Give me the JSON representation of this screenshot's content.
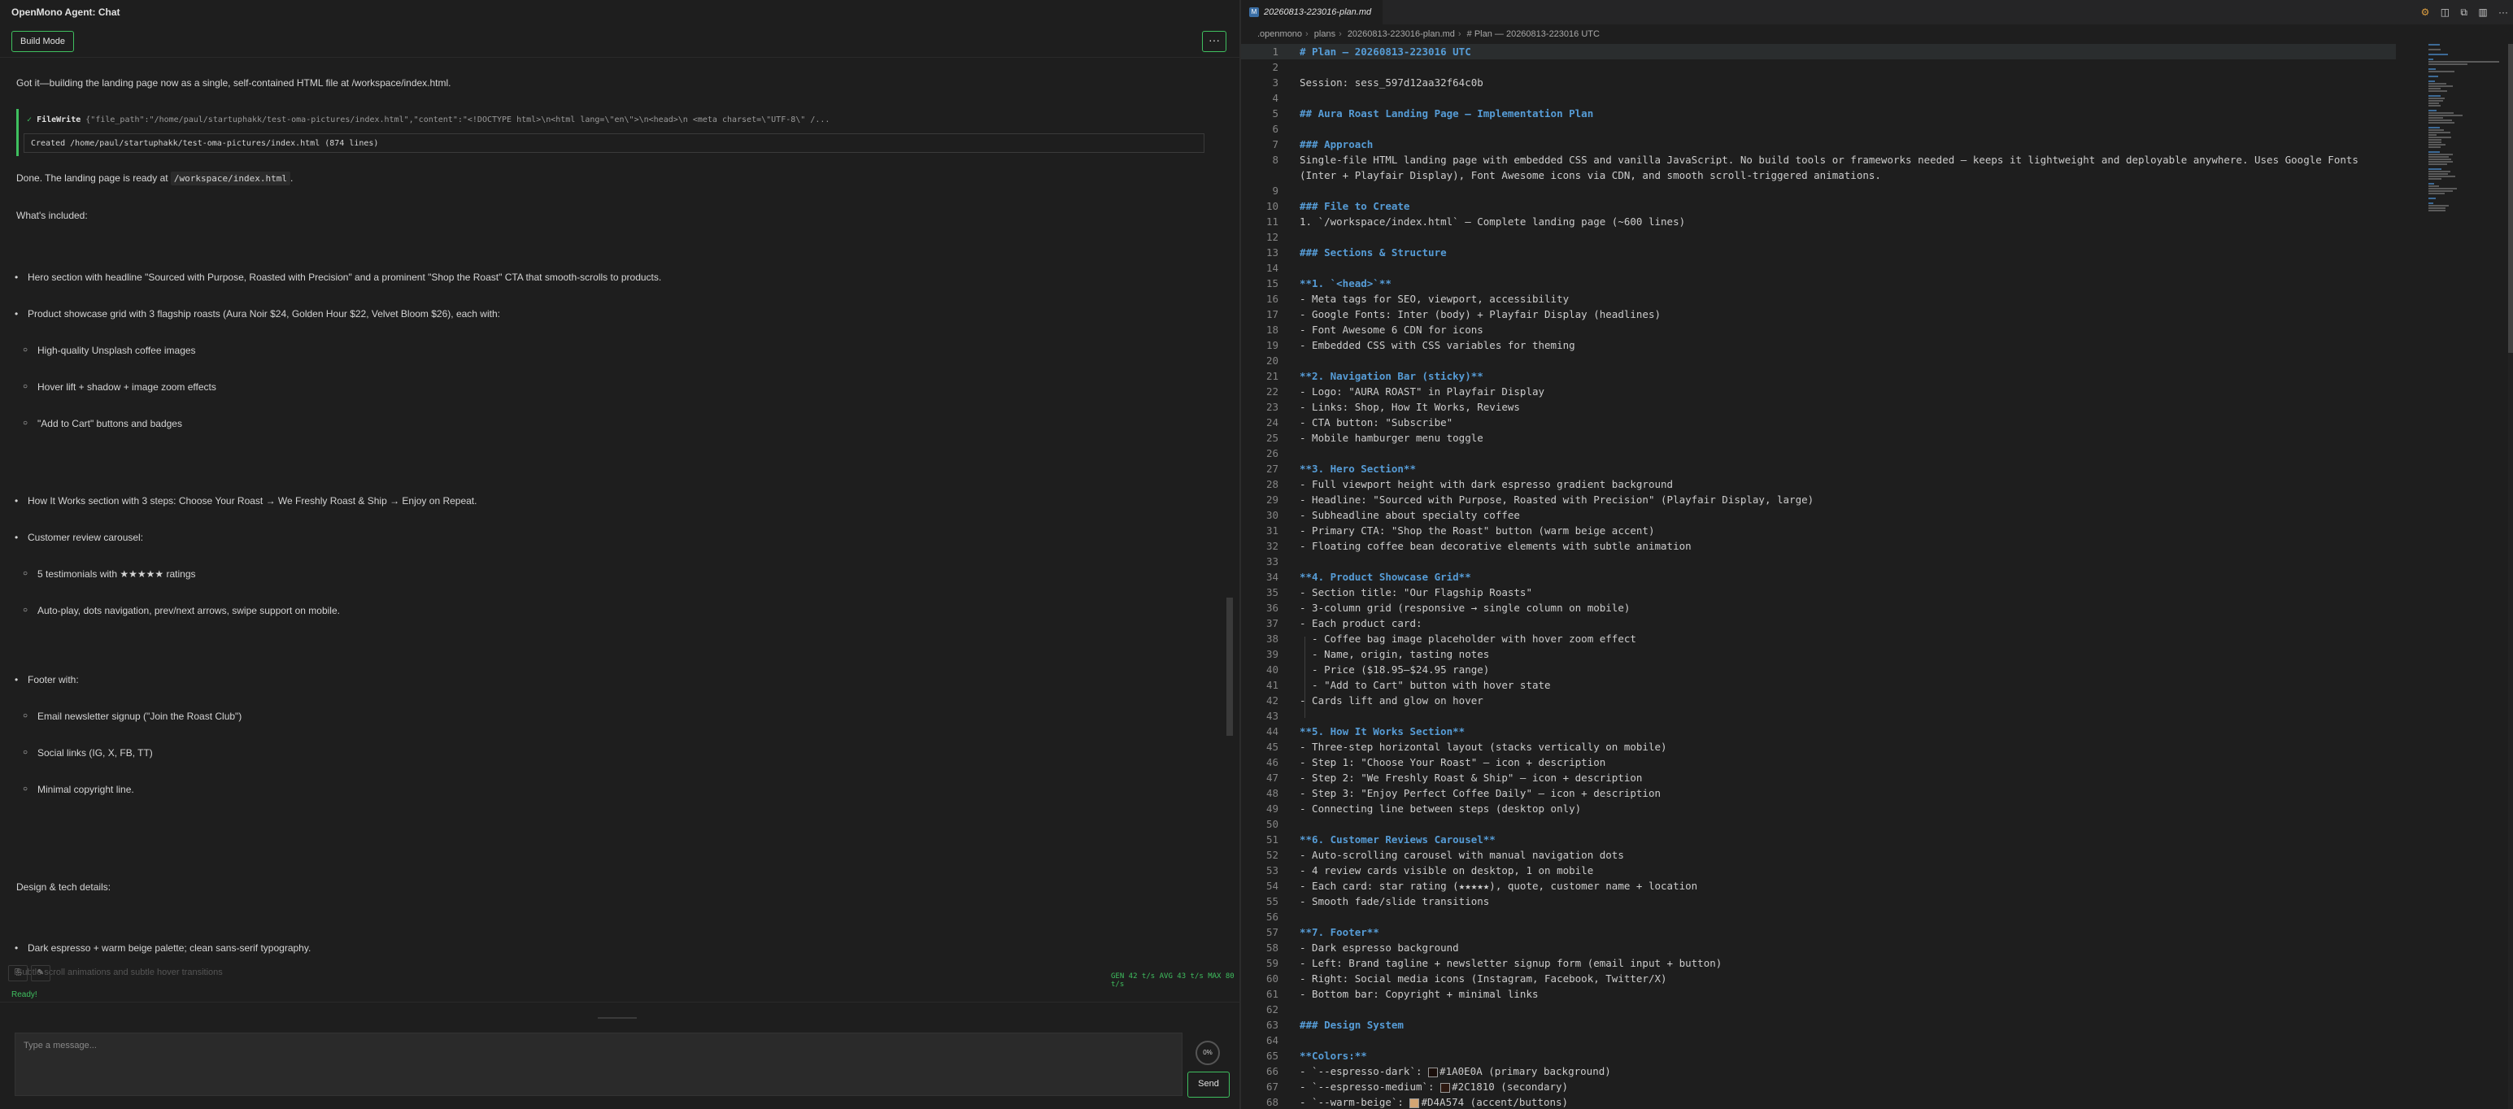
{
  "chat": {
    "title": "OpenMono Agent: Chat",
    "build_mode": "Build Mode",
    "more_label": "···",
    "intro": "Got it—building the landing page now as a single, self-contained HTML file at /workspace/index.html.",
    "tool": {
      "check": "✓",
      "name": "FileWrite",
      "args": "{\"file_path\":\"/home/paul/startuphakk/test-oma-pictures/index.html\",\"content\":\"<!DOCTYPE html>\\n<html lang=\\\"en\\\">\\n<head>\\n  <meta charset=\\\"UTF-8\\\" /...",
      "result": "Created /home/paul/startuphakk/test-oma-pictures/index.html (874 lines)"
    },
    "done_prefix": "Done. The landing page is ready at ",
    "done_path": "/workspace/index.html",
    "done_suffix": ".",
    "included": "What's included:",
    "bullets": {
      "hero": "Hero section with headline \"Sourced with Purpose, Roasted with Precision\" and a prominent \"Shop the Roast\" CTA that smooth-scrolls to products.",
      "product": "Product showcase grid with 3 flagship roasts (Aura Noir $24, Golden Hour $22, Velvet Bloom $26), each with:",
      "product_sub": [
        "High-quality Unsplash coffee images",
        "Hover lift + shadow + image zoom effects",
        "\"Add to Cart\" buttons and badges"
      ],
      "how": "How It Works section with 3 steps: Choose Your Roast → We Freshly Roast & Ship → Enjoy on Repeat.",
      "reviews": "Customer review carousel:",
      "reviews_sub": [
        "5 testimonials with ★★★★★ ratings",
        "Auto-play, dots navigation, prev/next arrows, swipe support on mobile."
      ],
      "footer": "Footer with:",
      "footer_sub": [
        "Email newsletter signup (\"Join the Roast Club\")",
        "Social links (IG, X, FB, TT)",
        "Minimal copyright line."
      ],
      "design_heading": "Design & tech details:",
      "design_first": "Dark espresso + warm beige palette; clean sans-serif typography.",
      "faded": "Subtle scroll animations and subtle hover transitions"
    },
    "gen_stats": "GEN 42 t/s AVG 43 t/s MAX 80 t/s",
    "status": "Ready!",
    "input_placeholder": "Type a message...",
    "progress": "0%",
    "send": "Send"
  },
  "editor": {
    "tab": "20260813-223016-plan.md",
    "breadcrumb": [
      ".openmono",
      "plans",
      "20260813-223016-plan.md",
      "# Plan — 20260813-223016 UTC"
    ],
    "lines": [
      {
        "n": "1",
        "t": "# Plan — 20260813-223016 UTC",
        "k": "h"
      },
      {
        "n": "2",
        "t": "",
        "k": ""
      },
      {
        "n": "3",
        "t": "Session: sess_597d12aa32f64c0b",
        "k": ""
      },
      {
        "n": "4",
        "t": "",
        "k": ""
      },
      {
        "n": "5",
        "t": "## Aura Roast Landing Page — Implementation Plan",
        "k": "h"
      },
      {
        "n": "6",
        "t": "",
        "k": ""
      },
      {
        "n": "7",
        "t": "### Approach",
        "k": "h"
      },
      {
        "n": "8",
        "t": "Single-file HTML landing page with embedded CSS and vanilla JavaScript. No build tools or frameworks needed — keeps it lightweight and deployable anywhere. Uses Google Fonts",
        "k": ""
      },
      {
        "n": "",
        "t": "(Inter + Playfair Display), Font Awesome icons via CDN, and smooth scroll-triggered animations.",
        "k": ""
      },
      {
        "n": "9",
        "t": "",
        "k": ""
      },
      {
        "n": "10",
        "t": "### File to Create",
        "k": "h"
      },
      {
        "n": "11",
        "t": "1. `/workspace/index.html` — Complete landing page (~600 lines)",
        "k": ""
      },
      {
        "n": "12",
        "t": "",
        "k": ""
      },
      {
        "n": "13",
        "t": "### Sections & Structure",
        "k": "h"
      },
      {
        "n": "14",
        "t": "",
        "k": ""
      },
      {
        "n": "15",
        "t": "**1. `<head>`**",
        "k": "b"
      },
      {
        "n": "16",
        "t": "- Meta tags for SEO, viewport, accessibility",
        "k": ""
      },
      {
        "n": "17",
        "t": "- Google Fonts: Inter (body) + Playfair Display (headlines)",
        "k": ""
      },
      {
        "n": "18",
        "t": "- Font Awesome 6 CDN for icons",
        "k": ""
      },
      {
        "n": "19",
        "t": "- Embedded CSS with CSS variables for theming",
        "k": ""
      },
      {
        "n": "20",
        "t": "",
        "k": ""
      },
      {
        "n": "21",
        "t": "**2. Navigation Bar (sticky)**",
        "k": "b"
      },
      {
        "n": "22",
        "t": "- Logo: \"AURA ROAST\" in Playfair Display",
        "k": ""
      },
      {
        "n": "23",
        "t": "- Links: Shop, How It Works, Reviews",
        "k": ""
      },
      {
        "n": "24",
        "t": "- CTA button: \"Subscribe\"",
        "k": ""
      },
      {
        "n": "25",
        "t": "- Mobile hamburger menu toggle",
        "k": ""
      },
      {
        "n": "26",
        "t": "",
        "k": ""
      },
      {
        "n": "27",
        "t": "**3. Hero Section**",
        "k": "b"
      },
      {
        "n": "28",
        "t": "- Full viewport height with dark espresso gradient background",
        "k": ""
      },
      {
        "n": "29",
        "t": "- Headline: \"Sourced with Purpose, Roasted with Precision\" (Playfair Display, large)",
        "k": ""
      },
      {
        "n": "30",
        "t": "- Subheadline about specialty coffee",
        "k": ""
      },
      {
        "n": "31",
        "t": "- Primary CTA: \"Shop the Roast\" button (warm beige accent)",
        "k": ""
      },
      {
        "n": "32",
        "t": "- Floating coffee bean decorative elements with subtle animation",
        "k": ""
      },
      {
        "n": "33",
        "t": "",
        "k": ""
      },
      {
        "n": "34",
        "t": "**4. Product Showcase Grid**",
        "k": "b"
      },
      {
        "n": "35",
        "t": "- Section title: \"Our Flagship Roasts\"",
        "k": ""
      },
      {
        "n": "36",
        "t": "- 3-column grid (responsive → single column on mobile)",
        "k": ""
      },
      {
        "n": "37",
        "t": "- Each product card:",
        "k": ""
      },
      {
        "n": "38",
        "t": "  - Coffee bag image placeholder with hover zoom effect",
        "k": ""
      },
      {
        "n": "39",
        "t": "  - Name, origin, tasting notes",
        "k": ""
      },
      {
        "n": "40",
        "t": "  - Price ($18.95–$24.95 range)",
        "k": ""
      },
      {
        "n": "41",
        "t": "  - \"Add to Cart\" button with hover state",
        "k": ""
      },
      {
        "n": "42",
        "t": "- Cards lift and glow on hover",
        "k": ""
      },
      {
        "n": "43",
        "t": "",
        "k": ""
      },
      {
        "n": "44",
        "t": "**5. How It Works Section**",
        "k": "b"
      },
      {
        "n": "45",
        "t": "- Three-step horizontal layout (stacks vertically on mobile)",
        "k": ""
      },
      {
        "n": "46",
        "t": "- Step 1: \"Choose Your Roast\" — icon + description",
        "k": ""
      },
      {
        "n": "47",
        "t": "- Step 2: \"We Freshly Roast & Ship\" — icon + description",
        "k": ""
      },
      {
        "n": "48",
        "t": "- Step 3: \"Enjoy Perfect Coffee Daily\" — icon + description",
        "k": ""
      },
      {
        "n": "49",
        "t": "- Connecting line between steps (desktop only)",
        "k": ""
      },
      {
        "n": "50",
        "t": "",
        "k": ""
      },
      {
        "n": "51",
        "t": "**6. Customer Reviews Carousel**",
        "k": "b"
      },
      {
        "n": "52",
        "t": "- Auto-scrolling carousel with manual navigation dots",
        "k": ""
      },
      {
        "n": "53",
        "t": "- 4 review cards visible on desktop, 1 on mobile",
        "k": ""
      },
      {
        "n": "54",
        "t": "- Each card: star rating (★★★★★), quote, customer name + location",
        "k": ""
      },
      {
        "n": "55",
        "t": "- Smooth fade/slide transitions",
        "k": ""
      },
      {
        "n": "56",
        "t": "",
        "k": ""
      },
      {
        "n": "57",
        "t": "**7. Footer**",
        "k": "b"
      },
      {
        "n": "58",
        "t": "- Dark espresso background",
        "k": ""
      },
      {
        "n": "59",
        "t": "- Left: Brand tagline + newsletter signup form (email input + button)",
        "k": ""
      },
      {
        "n": "60",
        "t": "- Right: Social media icons (Instagram, Facebook, Twitter/X)",
        "k": ""
      },
      {
        "n": "61",
        "t": "- Bottom bar: Copyright + minimal links",
        "k": ""
      },
      {
        "n": "62",
        "t": "",
        "k": ""
      },
      {
        "n": "63",
        "t": "### Design System",
        "k": "h"
      },
      {
        "n": "64",
        "t": "",
        "k": ""
      },
      {
        "n": "65",
        "t": "**Colors:**",
        "k": "b"
      },
      {
        "n": "66",
        "t": "- `--espresso-dark`: #1A0E0A (primary background)",
        "k": "c",
        "sw": "#1A0E0A"
      },
      {
        "n": "67",
        "t": "- `--espresso-medium`: #2C1810 (secondary)",
        "k": "c",
        "sw": "#2C1810"
      },
      {
        "n": "68",
        "t": "- `--warm-beige`: #D4A574 (accent/buttons)",
        "k": "c",
        "sw": "#D4A574"
      }
    ]
  },
  "colors": {
    "accent": "#3fbf5f",
    "heading": "#569cd6",
    "background": "#1e1e1e"
  }
}
